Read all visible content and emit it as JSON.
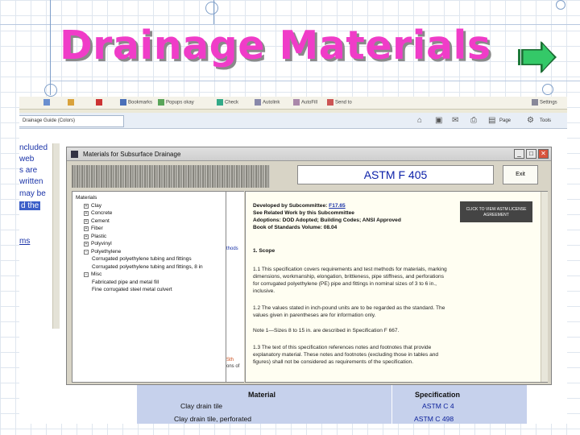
{
  "slide": {
    "title": "Drainage Materials"
  },
  "colors": {
    "title_pink": "#f03cc8",
    "arrow_green": "#2ecc71",
    "link_blue": "#1a33a8",
    "table_bg": "#c6d1ec"
  },
  "browser": {
    "toolbar": {
      "items": [
        "Bookmarks",
        "Popups okay",
        "Check",
        "Autolink",
        "AutoFill",
        "Send to",
        "Settings"
      ]
    },
    "tab_label": "Drainage Guide (Colors)",
    "nav": {
      "page_label": "Page",
      "tools_label": "Tools"
    }
  },
  "left_panel": {
    "lines": [
      "ncluded",
      "web",
      "s are",
      "written",
      "may  be",
      "d the"
    ],
    "link": "ms"
  },
  "dialog": {
    "title": "Materials for Subsurface Drainage",
    "astm_label": "ASTM F 405",
    "exit_label": "Exit",
    "tree": [
      {
        "label": "Materials",
        "level": 0,
        "expand": ""
      },
      {
        "label": "Clay",
        "level": 1,
        "expand": "+"
      },
      {
        "label": "Concrete",
        "level": 1,
        "expand": "+"
      },
      {
        "label": "Cement",
        "level": 1,
        "expand": "+"
      },
      {
        "label": "Fiber",
        "level": 1,
        "expand": "+"
      },
      {
        "label": "Plastic",
        "level": 1,
        "expand": "+"
      },
      {
        "label": "Polyvinyl",
        "level": 1,
        "expand": "+"
      },
      {
        "label": "Polyethylene",
        "level": 1,
        "expand": "−"
      },
      {
        "label": "Corrugated polyethylene tubing and fittings",
        "level": 2,
        "expand": ""
      },
      {
        "label": "Corrugated polyethylene tubing and fittings, 8 in",
        "level": 2,
        "expand": ""
      },
      {
        "label": "Misc",
        "level": 1,
        "expand": "−"
      },
      {
        "label": "Fabricated pipe and metal fill",
        "level": 2,
        "expand": ""
      },
      {
        "label": "Fine corrugated steel metal culvert",
        "level": 2,
        "expand": ""
      }
    ],
    "mid_fragments": {
      "top": "thods",
      "bottom_1": "Sth",
      "bottom_2": "ons of"
    },
    "view_button": "CLICK TO VIEW ASTM LICENSE AGREEMENT",
    "detail": {
      "developed_prefix": "Developed by Subcommittee: ",
      "subcommittee": "F17.65",
      "related": "See Related Work by this Subcommittee",
      "adoptions": "Adoptions: DOD Adopted; Building Codes; ANSI Approved",
      "book": "Book of Standards Volume: 08.04",
      "scope_heading": "1. Scope",
      "p1_1": "1.1 This specification covers requirements and test methods for materials, marking",
      "p1_2": "dimensions, workmanship, elongation, brittleness, pipe stiffness, and perforations",
      "p1_3": "for corrugated polyethylene (PE) pipe and fittings in nominal sizes of 3 to 6 in.,",
      "p1_4": "inclusive.",
      "p2_1": "1.2 The values stated in inch-pound units are to be regarded as the standard. The",
      "p2_2": "values given in parentheses are for information only.",
      "note": "Note 1—Sizes 8 to 15 in. are described in Specification F 667.",
      "p3_1": "1.3 The text of this specification references notes and footnotes that provide",
      "p3_2": "explanatory material. These notes and footnotes (excluding those in tables and",
      "p3_3": "figures) shall not be considered as requirements of the specification."
    }
  },
  "materials_table": {
    "material_header": "Material",
    "spec_header": "Specification",
    "rows": [
      {
        "material": "Clay drain tile",
        "spec": "ASTM C 4"
      },
      {
        "material": "Clay drain tile, perforated",
        "spec": "ASTM C 498"
      }
    ]
  }
}
